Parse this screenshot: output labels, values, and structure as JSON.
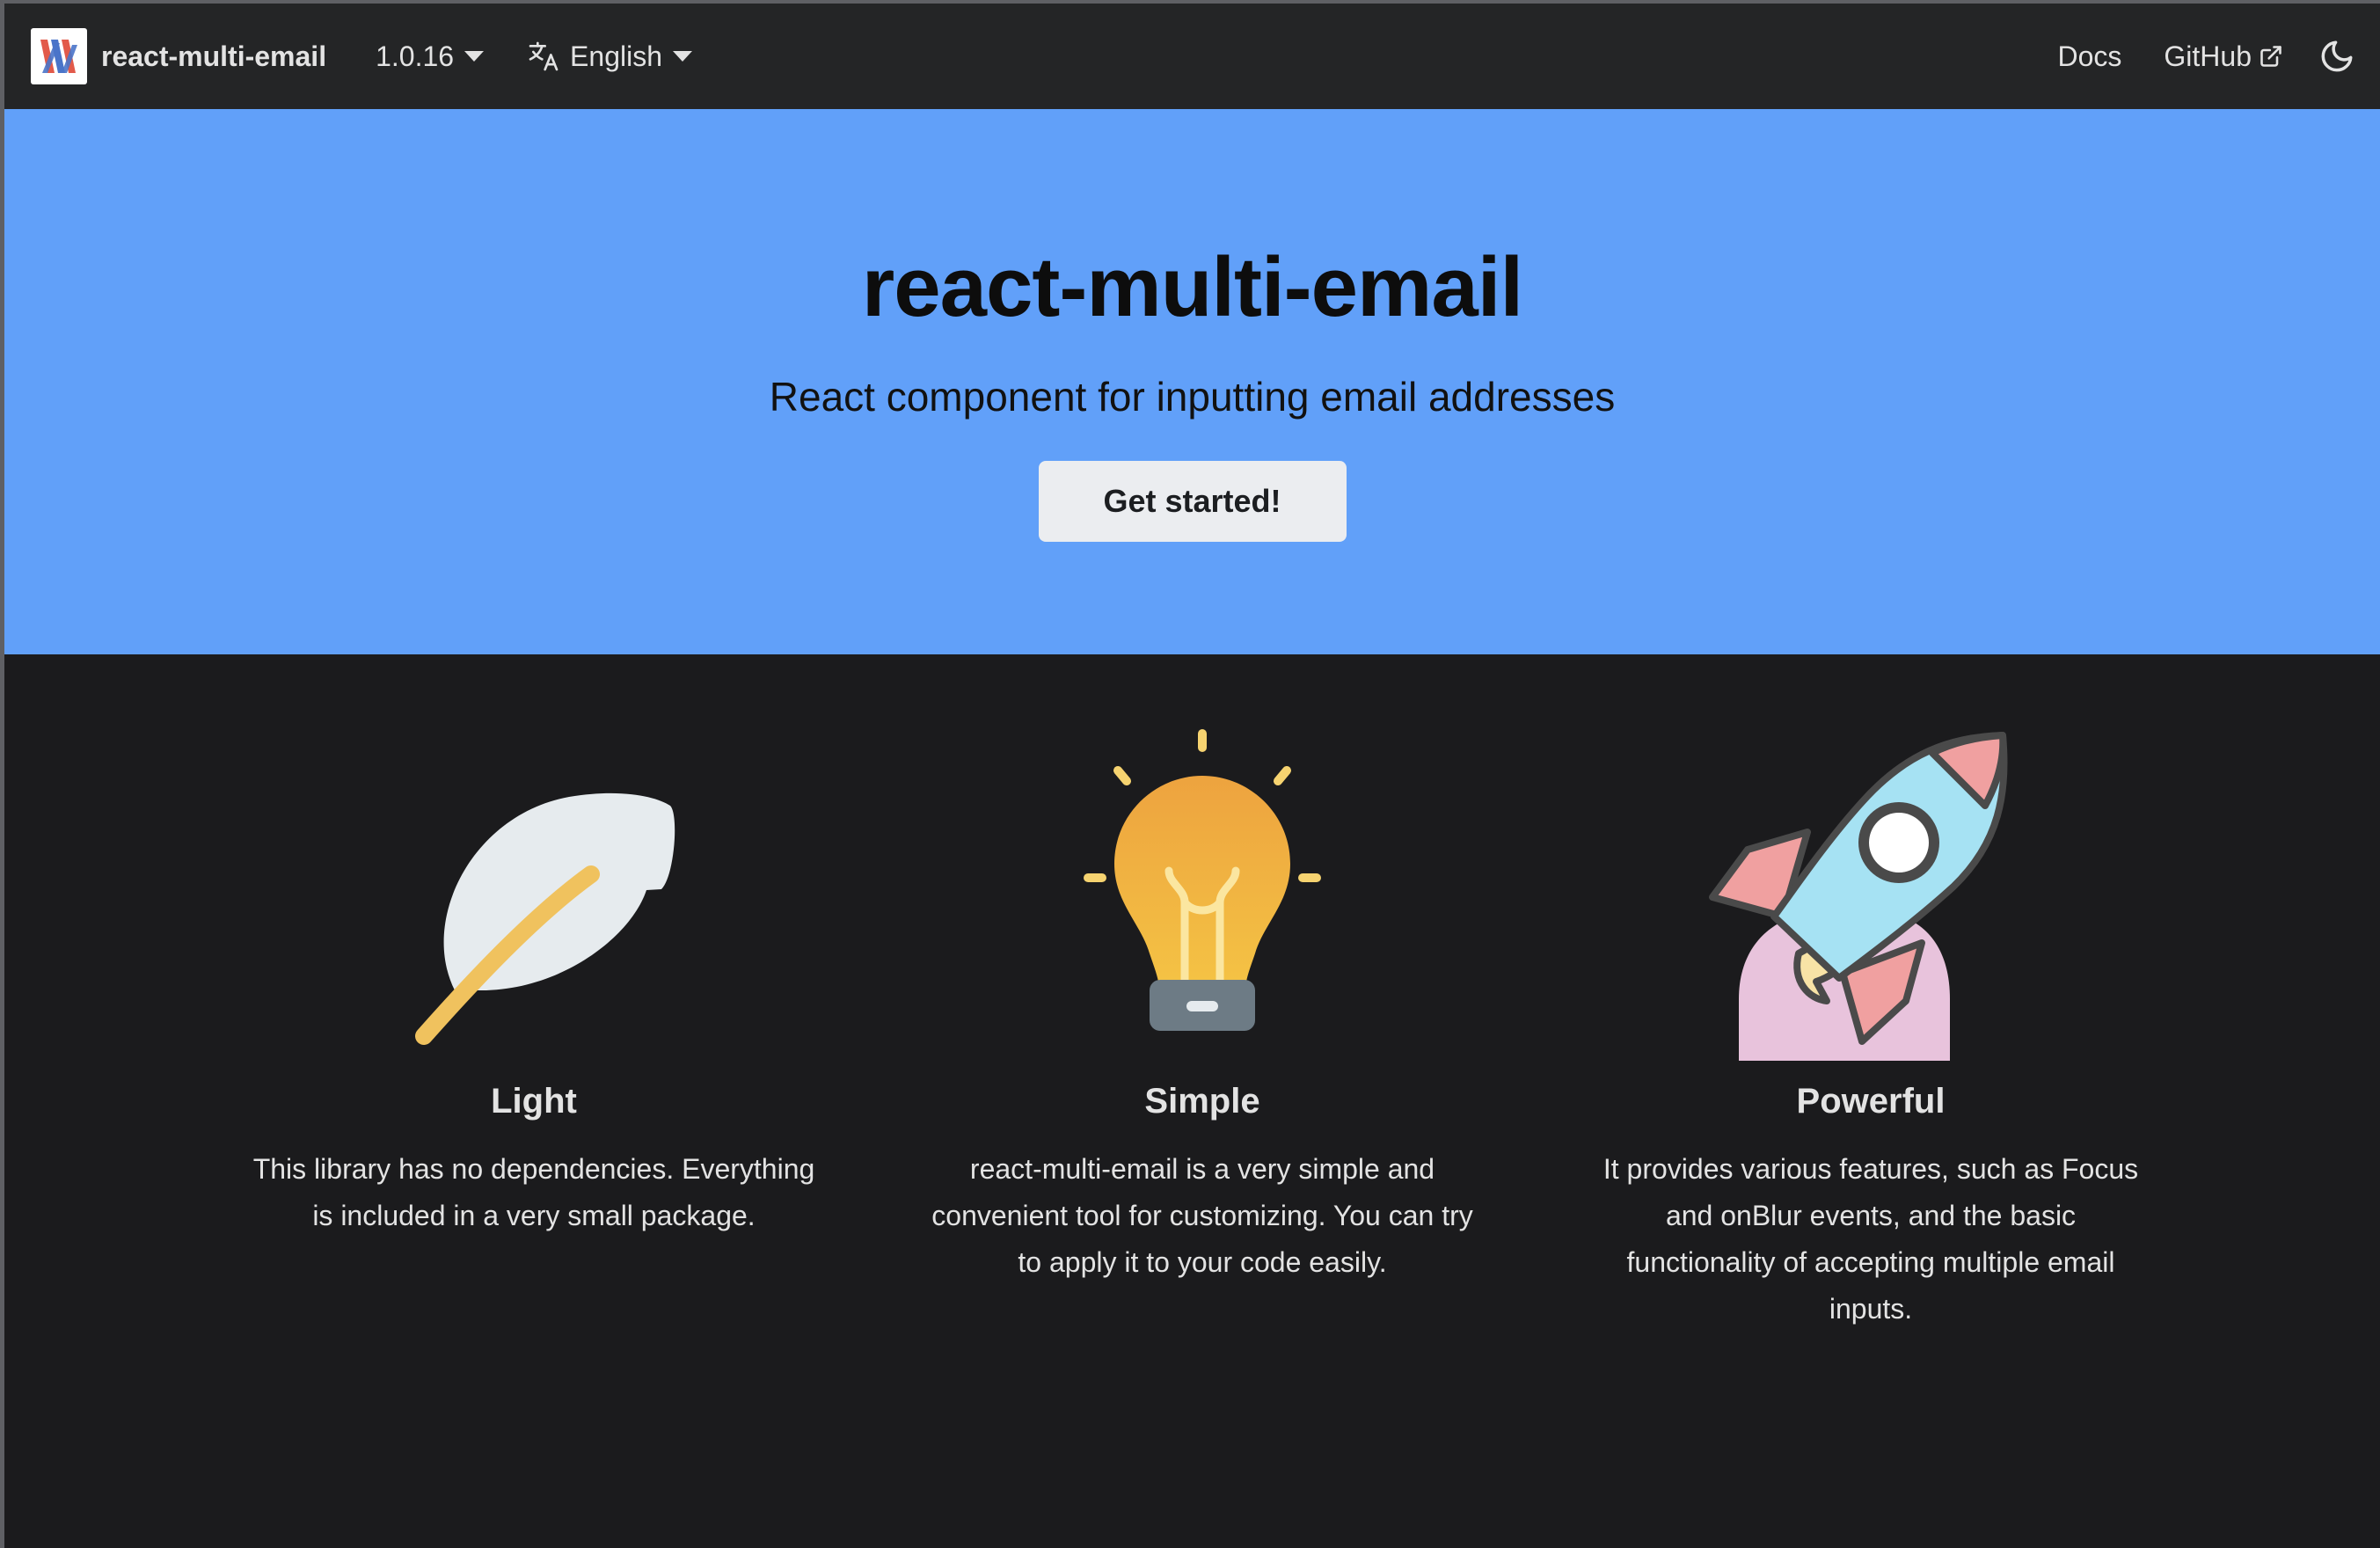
{
  "navbar": {
    "brand": "react-multi-email",
    "version": "1.0.16",
    "language": "English",
    "links": {
      "docs": "Docs",
      "github": "GitHub"
    }
  },
  "hero": {
    "title": "react-multi-email",
    "subtitle": "React component for inputting email addresses",
    "cta": "Get started!"
  },
  "features": [
    {
      "title": "Light",
      "description": "This library has no dependencies. Everything is included in a very small package.",
      "icon": "feather-icon"
    },
    {
      "title": "Simple",
      "description": "react-multi-email is a very simple and convenient tool for customizing. You can try to apply it to your code easily.",
      "icon": "lightbulb-icon"
    },
    {
      "title": "Powerful",
      "description": "It provides various features, such as Focus and onBlur events, and the basic functionality of accepting multiple email inputs.",
      "icon": "rocket-icon"
    }
  ],
  "colors": {
    "navbar_bg": "#242526",
    "hero_bg": "#61a0f9",
    "page_bg": "#1b1b1d",
    "cta_bg": "#ebedf0"
  }
}
